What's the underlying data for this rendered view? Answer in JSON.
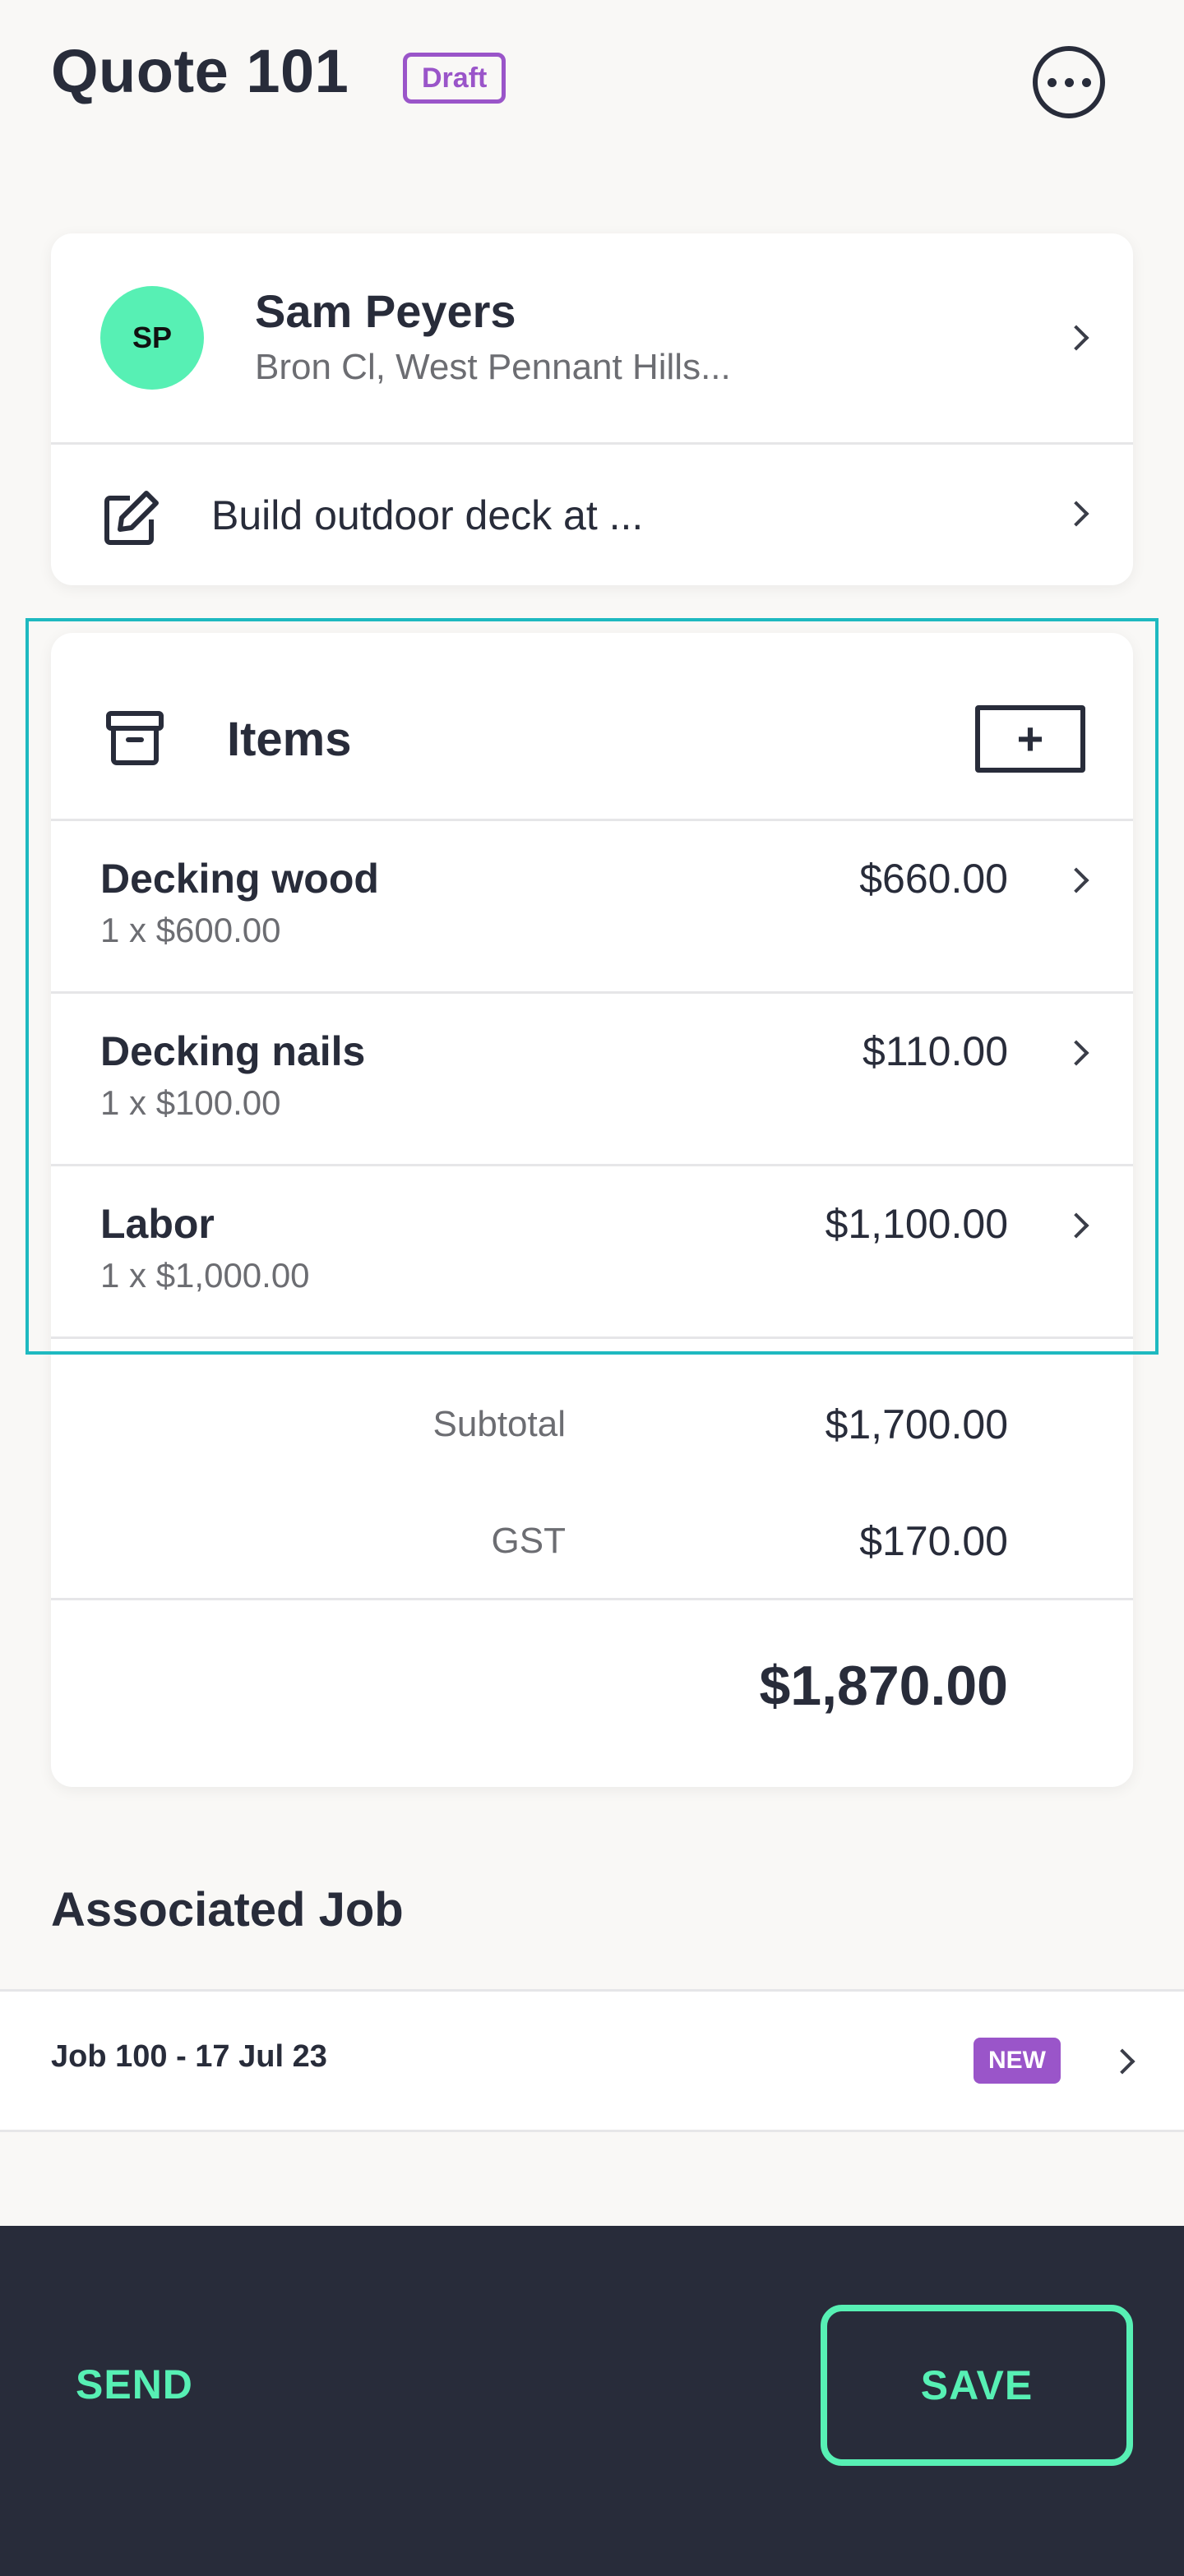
{
  "header": {
    "title": "Quote 101",
    "status_badge": "Draft"
  },
  "client": {
    "initials": "SP",
    "name": "Sam Peyers",
    "address": "Bron Cl, West Pennant Hills...",
    "avatar_color": "#57f0b4"
  },
  "job_description": "Build outdoor deck at ...",
  "items_section": {
    "title": "Items",
    "add_label": "+",
    "items": [
      {
        "name": "Decking wood",
        "qty_price": "1 x $600.00",
        "amount": "$660.00"
      },
      {
        "name": "Decking nails",
        "qty_price": "1 x $100.00",
        "amount": "$110.00"
      },
      {
        "name": "Labor",
        "qty_price": "1 x $1,000.00",
        "amount": "$1,100.00"
      }
    ],
    "subtotal_label": "Subtotal",
    "subtotal_value": "$1,700.00",
    "tax_label": "GST",
    "tax_value": "$170.00",
    "total_value": "$1,870.00"
  },
  "associated_job": {
    "section_title": "Associated Job",
    "label": "Job 100 - 17 Jul 23",
    "badge": "NEW"
  },
  "footer": {
    "send_label": "SEND",
    "save_label": "SAVE"
  },
  "colors": {
    "accent": "#57f0b4",
    "badge_purple": "#9a55c9",
    "highlight_outline": "#1eb9c0",
    "dark_bar": "#282c3a"
  },
  "icons": {
    "more": "more-options-icon",
    "edit": "edit-icon",
    "archive": "archive-box-icon",
    "chevron": "chevron-right-icon"
  }
}
